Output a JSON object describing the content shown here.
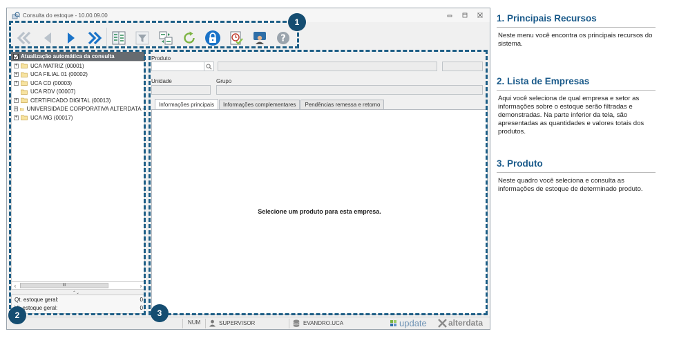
{
  "window": {
    "title": "Consulta do estoque - 10.00.09.00"
  },
  "toolbar": {
    "buttons": [
      {
        "name": "first-record",
        "icon": "double-chevron-left-icon"
      },
      {
        "name": "previous-record",
        "icon": "play-left-icon"
      },
      {
        "name": "next-record",
        "icon": "play-right-icon"
      },
      {
        "name": "last-record",
        "icon": "double-chevron-right-icon"
      },
      {
        "name": "list-view",
        "icon": "list-view-icon"
      },
      {
        "name": "filter",
        "icon": "funnel-icon"
      },
      {
        "name": "transfer",
        "icon": "swap-icon"
      },
      {
        "name": "refresh",
        "icon": "refresh-icon"
      },
      {
        "name": "lock",
        "icon": "padlock-icon"
      },
      {
        "name": "schedule",
        "icon": "clock-check-icon"
      },
      {
        "name": "support",
        "icon": "chat-person-icon"
      },
      {
        "name": "help",
        "icon": "question-icon"
      }
    ]
  },
  "tree": {
    "header": "Atualização automática da consulta",
    "items": [
      {
        "label": "UCA MATRIZ (00001)",
        "expandable": true
      },
      {
        "label": "UCA FILIAL 01 (00002)",
        "expandable": true
      },
      {
        "label": "UCA CD (00003)",
        "expandable": true
      },
      {
        "label": "UCA RDV (00007)",
        "expandable": false
      },
      {
        "label": "CERTIFICADO DIGITAL (00013)",
        "expandable": true
      },
      {
        "label": "UNIVERSIDADE CORPORATIVA ALTERDATA -",
        "expandable": true
      },
      {
        "label": "UCA MG (00017)",
        "expandable": true
      }
    ],
    "scroll_thumb": "III"
  },
  "totals": {
    "qty_label": "Qt. estoque geral:",
    "qty_value": "0",
    "value_label": "Vl. estoque geral:",
    "value_value": "0"
  },
  "product": {
    "produto_label": "Produto",
    "unidade_label": "Unidade",
    "grupo_label": "Grupo",
    "tabs": [
      {
        "label": "Informações principais",
        "active": true
      },
      {
        "label": "Informações complementares",
        "active": false
      },
      {
        "label": "Pendências remessa e retorno",
        "active": false
      }
    ],
    "empty_message": "Selecione um produto para esta empresa."
  },
  "statusbar": {
    "num": "NUM",
    "user": "SUPERVISOR",
    "database": "EVANDRO.UCA",
    "brand_update": "update",
    "brand_alterdata": "alterdata"
  },
  "callouts": {
    "one": "1",
    "two": "2",
    "three": "3"
  },
  "side": {
    "s1_title": "1. Principais Recursos",
    "s1_text": "Neste menu você encontra os principais recursos do sistema.",
    "s2_title": "2. Lista de Empresas",
    "s2_text": "Aqui você seleciona de qual empresa e setor as informações sobre o estoque serão filtradas e demonstradas. Na parte inferior da tela, são apresentadas as quantidades e valores totais dos produtos.",
    "s3_title": "3. Produto",
    "s3_text": "Neste quadro você seleciona e consulta as informações de estoque de determinado produto."
  },
  "colors": {
    "callout": "#1d5e86",
    "badge": "#154d71",
    "heading": "#1a5a8a",
    "nav_blue": "#1a73c8"
  }
}
